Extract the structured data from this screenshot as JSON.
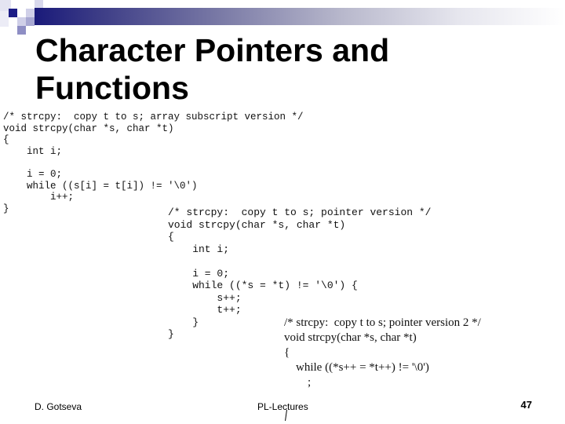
{
  "slide": {
    "title_lines": [
      "Character Pointers and",
      "Functions"
    ],
    "code_blocks": [
      {
        "name": "array-subscript-version",
        "lines": [
          "/* strcpy:  copy t to s; array subscript version */",
          "void strcpy(char *s, char *t)",
          "{",
          "    int i;",
          "",
          "    i = 0;",
          "    while ((s[i] = t[i]) != '\\0')",
          "        i++;",
          "}"
        ]
      },
      {
        "name": "pointer-version",
        "lines": [
          "/* strcpy:  copy t to s; pointer version */",
          "void strcpy(char *s, char *t)",
          "{",
          "    int i;",
          "",
          "    i = 0;",
          "    while ((*s = *t) != '\\0') {",
          "        s++;",
          "        t++;",
          "    }",
          "}"
        ]
      },
      {
        "name": "pointer-version-2",
        "lines": [
          "/* strcpy:  copy t to s; pointer version 2 */",
          "void strcpy(char *s, char *t)",
          "{",
          "    while ((*s++ = *t++) != '\\0')",
          "        ;"
        ]
      }
    ],
    "footer": {
      "author": "D. Gotseva",
      "course": "PL-Lectures",
      "page_number": "47"
    },
    "colors": {
      "accent_dark": "#1a1a7a",
      "accent_mid": "#7a7aa6",
      "accent_light": "#c8c8e0"
    }
  }
}
